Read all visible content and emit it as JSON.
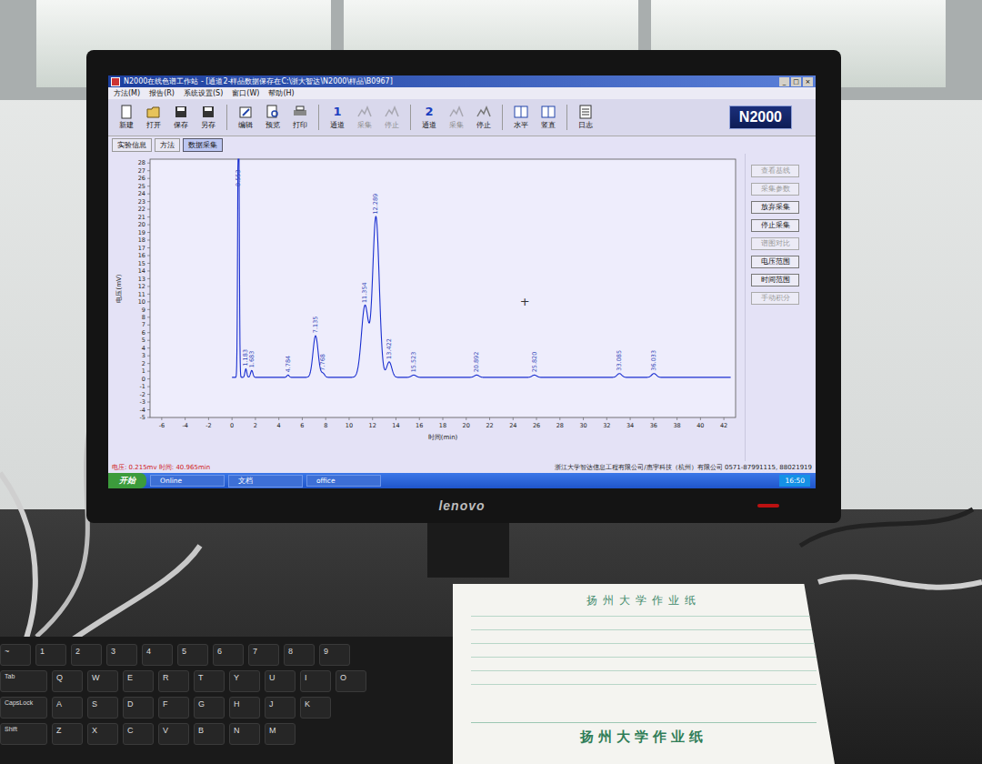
{
  "window": {
    "title": "N2000在线色谱工作站 - [通道2-样品数据保存在C:\\浙大智达\\N2000\\样品\\B0967]",
    "controls": [
      "_",
      "□",
      "×"
    ]
  },
  "menu": [
    "方法(M)",
    "报告(R)",
    "系统设置(S)",
    "窗口(W)",
    "帮助(H)"
  ],
  "toolbar": [
    {
      "label": "新建",
      "kind": "new",
      "badge": "",
      "disabled": false,
      "separator_before": false
    },
    {
      "label": "打开",
      "kind": "open",
      "badge": "",
      "disabled": false,
      "separator_before": false
    },
    {
      "label": "保存",
      "kind": "save",
      "badge": "",
      "disabled": false,
      "separator_before": false
    },
    {
      "label": "另存",
      "kind": "save",
      "badge": "",
      "disabled": false,
      "separator_before": false
    },
    {
      "label": "编辑",
      "kind": "edit",
      "badge": "",
      "disabled": false,
      "separator_before": true
    },
    {
      "label": "预览",
      "kind": "preview",
      "badge": "",
      "disabled": false,
      "separator_before": false
    },
    {
      "label": "打印",
      "kind": "print",
      "badge": "",
      "disabled": false,
      "separator_before": false
    },
    {
      "label": "通道",
      "kind": "channel",
      "badge": "1",
      "disabled": false,
      "separator_before": true
    },
    {
      "label": "采集",
      "kind": "acquire",
      "badge": "",
      "disabled": true,
      "separator_before": false
    },
    {
      "label": "停止",
      "kind": "acquire",
      "badge": "",
      "disabled": true,
      "separator_before": false
    },
    {
      "label": "通道",
      "kind": "channel",
      "badge": "2",
      "disabled": false,
      "separator_before": true
    },
    {
      "label": "采集",
      "kind": "acquire",
      "badge": "",
      "disabled": true,
      "separator_before": false
    },
    {
      "label": "停止",
      "kind": "acquire",
      "badge": "",
      "disabled": false,
      "separator_before": false
    },
    {
      "label": "水平",
      "kind": "tile",
      "badge": "",
      "disabled": false,
      "separator_before": true
    },
    {
      "label": "竖直",
      "kind": "tile",
      "badge": "",
      "disabled": false,
      "separator_before": false
    },
    {
      "label": "日志",
      "kind": "log",
      "badge": "",
      "disabled": false,
      "separator_before": true
    }
  ],
  "logo": "N2000",
  "tabs": [
    {
      "label": "实验信息",
      "selected": false
    },
    {
      "label": "方法",
      "selected": false
    },
    {
      "label": "数据采集",
      "selected": true
    }
  ],
  "chart": {
    "y_axis": {
      "title": "电压(mV)",
      "ticks": [
        "28",
        "27",
        "26",
        "25",
        "24",
        "23",
        "22",
        "21",
        "20",
        "19",
        "18",
        "17",
        "16",
        "15",
        "14",
        "13",
        "12",
        "11",
        "10",
        "9",
        "8",
        "7",
        "6",
        "5",
        "4",
        "3",
        "2",
        "1",
        "0",
        "-1",
        "-2",
        "-3",
        "-4",
        "-5"
      ]
    },
    "x_axis": {
      "title": "时间(min)",
      "ticks": [
        "-6",
        "-4",
        "-2",
        "0",
        "2",
        "4",
        "6",
        "8",
        "10",
        "12",
        "14",
        "16",
        "18",
        "20",
        "22",
        "24",
        "26",
        "28",
        "30",
        "32",
        "34",
        "36",
        "38",
        "40",
        "42"
      ]
    },
    "baseline": 0.2,
    "peaks": [
      {
        "label": "0.553",
        "time": 0.553,
        "height": 40,
        "width": 0.06
      },
      {
        "label": "1.183",
        "time": 1.183,
        "height": 1.1,
        "width": 0.08
      },
      {
        "label": "1.683",
        "time": 1.683,
        "height": 0.9,
        "width": 0.1
      },
      {
        "label": "4.784",
        "time": 4.784,
        "height": 0.3,
        "width": 0.1
      },
      {
        "label": "7.135",
        "time": 7.135,
        "height": 5.4,
        "width": 0.22
      },
      {
        "label": "7.768",
        "time": 7.768,
        "height": 0.5,
        "width": 0.15
      },
      {
        "label": "11.354",
        "time": 11.354,
        "height": 9.3,
        "width": 0.3
      },
      {
        "label": "12.289",
        "time": 12.289,
        "height": 20.8,
        "width": 0.28
      },
      {
        "label": "13.422",
        "time": 13.422,
        "height": 2.0,
        "width": 0.22
      },
      {
        "label": "15.523",
        "time": 15.523,
        "height": 0.3,
        "width": 0.2
      },
      {
        "label": "20.892",
        "time": 20.892,
        "height": 0.3,
        "width": 0.2
      },
      {
        "label": "25.820",
        "time": 25.82,
        "height": 0.3,
        "width": 0.2
      },
      {
        "label": "33.085",
        "time": 33.085,
        "height": 0.5,
        "width": 0.2
      },
      {
        "label": "36.033",
        "time": 36.033,
        "height": 0.5,
        "width": 0.2
      }
    ],
    "cursor": {
      "glyph": "+",
      "time": 25,
      "voltage": 10
    }
  },
  "side_buttons": [
    {
      "label": "查看基线",
      "disabled": true
    },
    {
      "label": "采集参数",
      "disabled": true
    },
    {
      "label": "放弃采集",
      "disabled": false
    },
    {
      "label": "停止采集",
      "disabled": false
    },
    {
      "label": "谱图对比",
      "disabled": true
    },
    {
      "label": "电压范围",
      "disabled": false
    },
    {
      "label": "时间范围",
      "disabled": false
    },
    {
      "label": "手动积分",
      "disabled": true
    }
  ],
  "status": "电压: 0.215mv 时间: 40.965min",
  "footer": "浙江大学智达信息工程有限公司/惠宇科技（杭州）有限公司 0571-87991115, 88021919",
  "taskbar": {
    "start": "开始",
    "items": [
      "Online",
      "文档",
      "office"
    ],
    "clock": "16:50"
  },
  "monitor": {
    "brand": "lenovo"
  },
  "paper": {
    "header": "扬州大学作业纸",
    "footer": "扬州大学作业纸"
  },
  "keyboard": {
    "rows": [
      [
        "~",
        "1",
        "2",
        "3",
        "4",
        "5",
        "6",
        "7",
        "8",
        "9"
      ],
      [
        "Tab",
        "Q",
        "W",
        "E",
        "R",
        "T",
        "Y",
        "U",
        "I",
        "O"
      ],
      [
        "CapsLock",
        "A",
        "S",
        "D",
        "F",
        "G",
        "H",
        "J",
        "K"
      ],
      [
        "Shift",
        "Z",
        "X",
        "C",
        "V",
        "B",
        "N",
        "M"
      ]
    ]
  }
}
